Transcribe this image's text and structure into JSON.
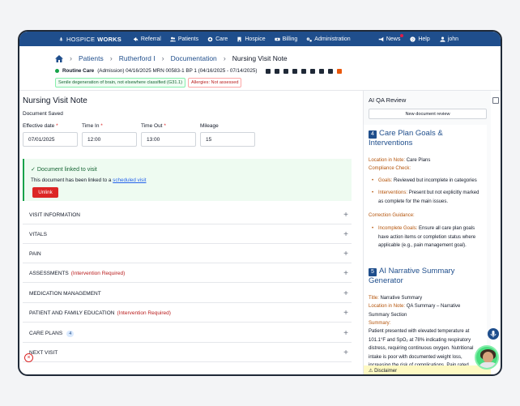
{
  "nav": {
    "brand_light": "HOSPICE",
    "brand_bold": "WORKS",
    "items": [
      "Referral",
      "Patients",
      "Care",
      "Hospice",
      "Billing",
      "Administration"
    ],
    "news": "News",
    "help": "Help",
    "user": "john"
  },
  "breadcrumb": [
    "Patients",
    "Rutherford I",
    "Documentation",
    "Nursing Visit Note"
  ],
  "patient": {
    "line_bold": "Routine Care",
    "line_rest": "(Admission) 04/16/2025 MRN 00583-1 BP 1 (04/16/2025 - 07/14/2025)"
  },
  "tags": {
    "diagnosis": "Senile degeneration of brain, not elsewhere classified (G31.1)",
    "allergies": "Allergies: Not assessed"
  },
  "form": {
    "title": "Nursing Visit Note",
    "status": "Document Saved",
    "effective_date_label": "Effective date",
    "effective_date": "07/01/2025",
    "time_in_label": "Time In",
    "time_in": "12:00",
    "time_out_label": "Time Out",
    "time_out": "13:00",
    "mileage_label": "Mileage",
    "mileage": "15"
  },
  "linked": {
    "heading": "Document linked to visit",
    "text": "This document has been linked to a",
    "link": "scheduled visit",
    "unlink": "Unlink"
  },
  "sections": [
    {
      "label": "VISIT INFORMATION",
      "req": "",
      "count": ""
    },
    {
      "label": "VITALS",
      "req": "",
      "count": ""
    },
    {
      "label": "PAIN",
      "req": "",
      "count": ""
    },
    {
      "label": "ASSESSMENTS",
      "req": "(Intervention Required)",
      "count": ""
    },
    {
      "label": "MEDICATION MANAGEMENT",
      "req": "",
      "count": ""
    },
    {
      "label": "PATIENT AND FAMILY EDUCATION",
      "req": "(Intervention Required)",
      "count": ""
    },
    {
      "label": "CARE PLANS",
      "req": "",
      "count": "4"
    },
    {
      "label": "NEXT VISIT",
      "req": "",
      "count": ""
    }
  ],
  "qa": {
    "title": "AI QA Review",
    "new_review": "New document review",
    "care_plan_num": "4",
    "care_plan_title": "Care Plan Goals & Interventions",
    "loc_label": "Location in Note:",
    "loc_value": "Care Plans",
    "compliance": "Compliance Check:",
    "goals_label": "Goals:",
    "goals_text": "Reviewed but incomplete in categories",
    "interv_label": "Interventions:",
    "interv_text": "Present but not explicitly marked as complete for the main issues.",
    "correction": "Correction Guidance:",
    "incomplete_label": "Incomplete Goals:",
    "incomplete_text": "Ensure all care plan goals have action items or completion status where applicable (e.g., pain management goal).",
    "narr_num": "5",
    "narr_title": "AI Narrative Summary Generator",
    "n_title_label": "Title:",
    "n_title_value": "Narrative Summary",
    "n_loc_label": "Location in Note:",
    "n_loc_value": "QA Summary – Narrative Summary Section",
    "summary_label": "Summary:",
    "summary_text": "Patient presented with elevated temperature at 101.1°F and SpO₂ at 78% indicating respiratory distress, requiring continuous oxygen. Nutritional intake is poor with documented weight loss, increasing the risk of complications. Pain rated",
    "disclaimer": "Disclaimer"
  }
}
